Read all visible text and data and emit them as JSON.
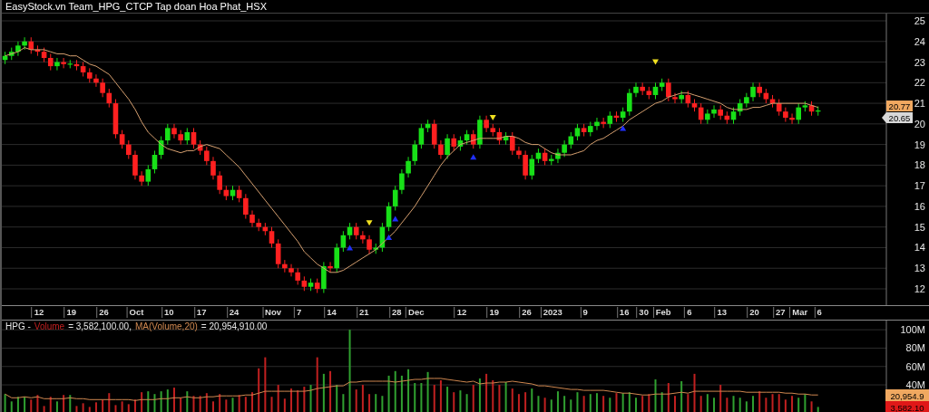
{
  "window": {
    "title": "EasyStock.vn Team_HPG_CTCP Tap doan Hoa Phat_HSX"
  },
  "price_chart": {
    "chart_data": {
      "type": "candlestick",
      "grid": true,
      "ylim": [
        12,
        25
      ],
      "yticks": [
        12,
        13,
        14,
        15,
        16,
        17,
        18,
        19,
        20,
        21,
        22,
        23,
        24,
        25
      ],
      "categories": [
        null,
        null,
        null,
        null,
        null,
        "12",
        null,
        null,
        null,
        null,
        "19",
        null,
        null,
        null,
        null,
        "26",
        null,
        null,
        null,
        null,
        "Oct",
        null,
        null,
        null,
        null,
        "10",
        null,
        null,
        null,
        null,
        "17",
        null,
        null,
        null,
        null,
        "24",
        null,
        null,
        null,
        null,
        null,
        "Nov",
        null,
        null,
        null,
        "7",
        null,
        null,
        null,
        null,
        "14",
        null,
        null,
        null,
        null,
        "21",
        null,
        null,
        null,
        null,
        "28",
        null,
        null,
        "Dec",
        null,
        null,
        null,
        null,
        null,
        null,
        "12",
        null,
        null,
        null,
        null,
        "19",
        null,
        null,
        null,
        null,
        "26",
        null,
        null,
        null,
        "2023",
        null,
        null,
        null,
        null,
        "9",
        null,
        null,
        null,
        null,
        null,
        "16",
        null,
        null,
        "30",
        null,
        null,
        "Feb",
        null,
        null,
        null,
        "6",
        null,
        null,
        null,
        null,
        "13",
        null,
        null,
        null,
        null,
        "20",
        null,
        null,
        null,
        "27",
        null,
        null,
        "Mar",
        null,
        null,
        "6"
      ],
      "ohlc": [
        [
          23.1,
          23.5,
          22.9,
          23.3
        ],
        [
          23.3,
          23.7,
          23.1,
          23.5
        ],
        [
          23.5,
          24.0,
          23.3,
          23.8
        ],
        [
          23.8,
          24.2,
          23.6,
          24.0
        ],
        [
          24.0,
          24.2,
          23.4,
          23.6
        ],
        [
          23.6,
          23.8,
          23.3,
          23.5
        ],
        [
          23.5,
          23.7,
          23.0,
          23.2
        ],
        [
          23.2,
          23.4,
          22.6,
          22.8
        ],
        [
          22.8,
          23.2,
          22.6,
          23.0
        ],
        [
          23.0,
          23.2,
          22.7,
          22.9
        ],
        [
          22.9,
          23.1,
          22.7,
          22.9
        ],
        [
          22.9,
          23.1,
          22.6,
          22.8
        ],
        [
          22.8,
          23.0,
          22.3,
          22.5
        ],
        [
          22.5,
          22.7,
          22.0,
          22.2
        ],
        [
          22.2,
          22.4,
          21.8,
          22.0
        ],
        [
          22.0,
          22.2,
          21.3,
          21.5
        ],
        [
          21.5,
          21.7,
          20.8,
          21.0
        ],
        [
          21.0,
          21.2,
          19.3,
          19.5
        ],
        [
          19.5,
          19.7,
          18.8,
          19.0
        ],
        [
          19.0,
          19.2,
          18.3,
          18.5
        ],
        [
          18.5,
          18.7,
          17.3,
          17.5
        ],
        [
          17.5,
          17.7,
          17.0,
          17.2
        ],
        [
          17.2,
          18.0,
          17.0,
          17.8
        ],
        [
          17.8,
          18.7,
          17.6,
          18.5
        ],
        [
          18.5,
          19.4,
          18.3,
          19.2
        ],
        [
          19.2,
          20.0,
          19.0,
          19.8
        ],
        [
          19.8,
          20.0,
          19.3,
          19.5
        ],
        [
          19.5,
          19.7,
          19.0,
          19.2
        ],
        [
          19.2,
          19.8,
          19.0,
          19.6
        ],
        [
          19.6,
          19.8,
          18.8,
          19.0
        ],
        [
          19.0,
          19.2,
          18.5,
          18.7
        ],
        [
          18.7,
          18.9,
          18.0,
          18.2
        ],
        [
          18.2,
          18.4,
          17.3,
          17.5
        ],
        [
          17.5,
          17.7,
          16.6,
          16.8
        ],
        [
          16.8,
          17.0,
          16.3,
          16.5
        ],
        [
          16.5,
          17.0,
          16.3,
          16.8
        ],
        [
          16.8,
          17.0,
          16.2,
          16.4
        ],
        [
          16.4,
          16.6,
          15.4,
          15.6
        ],
        [
          15.6,
          15.8,
          15.0,
          15.2
        ],
        [
          15.2,
          15.4,
          14.8,
          15.0
        ],
        [
          15.0,
          15.2,
          14.6,
          14.8
        ],
        [
          14.8,
          15.0,
          14.0,
          14.2
        ],
        [
          14.2,
          14.4,
          13.0,
          13.2
        ],
        [
          13.2,
          13.4,
          12.8,
          13.0
        ],
        [
          13.0,
          13.2,
          12.6,
          12.8
        ],
        [
          12.8,
          13.0,
          12.2,
          12.4
        ],
        [
          12.4,
          12.6,
          11.9,
          12.1
        ],
        [
          12.1,
          12.5,
          11.9,
          12.3
        ],
        [
          12.3,
          12.5,
          11.8,
          12.0
        ],
        [
          12.0,
          13.3,
          11.8,
          13.1
        ],
        [
          13.1,
          13.3,
          12.8,
          13.0
        ],
        [
          13.0,
          14.2,
          12.8,
          14.0
        ],
        [
          14.0,
          14.8,
          13.8,
          14.6
        ],
        [
          14.6,
          15.2,
          14.4,
          15.0
        ],
        [
          15.0,
          15.2,
          14.4,
          14.6
        ],
        [
          14.6,
          14.8,
          14.2,
          14.4
        ],
        [
          14.4,
          14.6,
          13.7,
          13.9
        ],
        [
          13.9,
          14.2,
          13.7,
          14.0
        ],
        [
          14.0,
          15.2,
          13.8,
          15.0
        ],
        [
          15.0,
          16.2,
          14.8,
          16.0
        ],
        [
          16.0,
          17.0,
          15.8,
          16.8
        ],
        [
          16.8,
          17.8,
          16.6,
          17.6
        ],
        [
          17.6,
          18.4,
          17.4,
          18.2
        ],
        [
          18.2,
          19.2,
          18.0,
          19.0
        ],
        [
          19.0,
          20.0,
          18.8,
          19.8
        ],
        [
          19.8,
          20.2,
          19.6,
          20.0
        ],
        [
          20.0,
          20.2,
          18.8,
          19.0
        ],
        [
          19.0,
          19.2,
          18.3,
          18.5
        ],
        [
          18.5,
          19.5,
          18.3,
          19.3
        ],
        [
          19.3,
          19.5,
          18.7,
          18.9
        ],
        [
          18.9,
          19.4,
          18.7,
          19.2
        ],
        [
          19.2,
          19.7,
          19.0,
          19.5
        ],
        [
          19.5,
          19.7,
          18.8,
          19.0
        ],
        [
          19.0,
          20.4,
          18.8,
          20.2
        ],
        [
          20.2,
          20.4,
          19.6,
          19.8
        ],
        [
          19.8,
          20.0,
          19.4,
          19.6
        ],
        [
          19.6,
          19.8,
          19.0,
          19.2
        ],
        [
          19.2,
          19.6,
          19.0,
          19.4
        ],
        [
          19.4,
          19.6,
          18.5,
          18.7
        ],
        [
          18.7,
          18.9,
          18.3,
          18.5
        ],
        [
          18.5,
          18.7,
          17.3,
          17.5
        ],
        [
          17.5,
          18.5,
          17.3,
          18.3
        ],
        [
          18.3,
          18.8,
          18.1,
          18.6
        ],
        [
          18.6,
          18.8,
          18.0,
          18.2
        ],
        [
          18.2,
          18.5,
          18.0,
          18.3
        ],
        [
          18.3,
          18.8,
          18.1,
          18.6
        ],
        [
          18.6,
          19.2,
          18.4,
          19.0
        ],
        [
          19.0,
          19.6,
          18.8,
          19.4
        ],
        [
          19.4,
          20.0,
          19.2,
          19.8
        ],
        [
          19.8,
          20.0,
          19.4,
          19.6
        ],
        [
          19.6,
          20.1,
          19.4,
          19.9
        ],
        [
          19.9,
          20.3,
          19.7,
          20.1
        ],
        [
          20.1,
          20.3,
          19.8,
          20.0
        ],
        [
          20.0,
          20.6,
          19.8,
          20.4
        ],
        [
          20.4,
          20.6,
          20.1,
          20.3
        ],
        [
          20.3,
          20.8,
          20.1,
          20.6
        ],
        [
          20.6,
          21.7,
          20.4,
          21.5
        ],
        [
          21.5,
          22.0,
          21.3,
          21.8
        ],
        [
          21.8,
          22.0,
          21.4,
          21.6
        ],
        [
          21.6,
          21.8,
          21.2,
          21.4
        ],
        [
          21.4,
          22.0,
          21.2,
          21.8
        ],
        [
          21.8,
          22.2,
          21.6,
          22.0
        ],
        [
          22.0,
          22.2,
          21.1,
          21.3
        ],
        [
          21.3,
          21.5,
          21.0,
          21.2
        ],
        [
          21.2,
          21.6,
          21.0,
          21.4
        ],
        [
          21.4,
          21.6,
          20.8,
          21.0
        ],
        [
          21.0,
          21.2,
          20.6,
          20.8
        ],
        [
          20.8,
          21.0,
          20.0,
          20.2
        ],
        [
          20.2,
          20.7,
          20.0,
          20.5
        ],
        [
          20.5,
          20.9,
          20.3,
          20.7
        ],
        [
          20.7,
          20.9,
          20.2,
          20.4
        ],
        [
          20.4,
          20.6,
          20.0,
          20.2
        ],
        [
          20.2,
          20.8,
          20.0,
          20.6
        ],
        [
          20.6,
          21.2,
          20.4,
          21.0
        ],
        [
          21.0,
          21.5,
          20.8,
          21.3
        ],
        [
          21.3,
          22.0,
          21.1,
          21.8
        ],
        [
          21.8,
          22.0,
          21.3,
          21.5
        ],
        [
          21.5,
          21.7,
          21.0,
          21.2
        ],
        [
          21.2,
          21.4,
          20.8,
          21.0
        ],
        [
          21.0,
          21.2,
          20.4,
          20.6
        ],
        [
          20.6,
          20.8,
          20.1,
          20.3
        ],
        [
          20.3,
          20.5,
          20.0,
          20.2
        ],
        [
          20.2,
          21.0,
          20.0,
          20.8
        ],
        [
          20.8,
          21.1,
          20.6,
          20.9
        ],
        [
          20.9,
          21.1,
          20.4,
          20.6
        ],
        [
          20.6,
          20.85,
          20.4,
          20.65
        ]
      ],
      "series": [
        {
          "type": "line",
          "color": "#d6a070",
          "values": [
            23.3,
            23.4,
            23.5,
            23.7,
            23.6,
            23.6,
            23.6,
            23.5,
            23.4,
            23.4,
            23.3,
            23.3,
            23.1,
            22.9,
            22.8,
            22.6,
            22.4,
            22.0,
            21.6,
            21.2,
            20.7,
            20.1,
            19.6,
            19.3,
            19.0,
            18.8,
            18.7,
            18.6,
            18.7,
            18.7,
            18.9,
            19.0,
            18.9,
            18.8,
            18.5,
            18.2,
            17.9,
            17.5,
            17.1,
            16.7,
            16.3,
            15.9,
            15.5,
            15.1,
            14.7,
            14.3,
            13.8,
            13.5,
            13.2,
            13.0,
            12.8,
            12.8,
            12.9,
            13.1,
            13.3,
            13.5,
            13.7,
            13.9,
            14.2,
            14.5,
            14.8,
            15.2,
            15.6,
            16.0,
            16.5,
            17.0,
            17.5,
            18.0,
            18.4,
            18.7,
            19.0,
            19.1,
            19.2,
            19.3,
            19.3,
            19.3,
            19.3,
            19.4,
            19.4,
            19.3,
            19.1,
            19.0,
            19.0,
            18.8,
            18.6,
            18.5,
            18.5,
            18.5,
            18.6,
            18.7,
            19.0,
            19.2,
            19.3,
            19.5,
            19.7,
            19.9,
            20.2,
            20.4,
            20.6,
            20.8,
            21.0,
            21.1,
            21.3,
            21.4,
            21.5,
            21.5,
            21.4,
            21.3,
            21.2,
            21.1,
            21.0,
            20.8,
            20.7,
            20.7,
            20.7,
            20.8,
            20.8,
            20.9,
            21.0,
            21.0,
            21.0,
            21.0,
            21.0,
            21.0,
            20.9,
            20.8
          ]
        },
        {
          "type": "scatter",
          "color": "#2030ff",
          "values": [
            null,
            null,
            null,
            null,
            null,
            null,
            null,
            null,
            null,
            null,
            null,
            null,
            null,
            null,
            null,
            null,
            null,
            null,
            null,
            null,
            null,
            null,
            null,
            null,
            null,
            null,
            null,
            null,
            null,
            null,
            null,
            null,
            null,
            null,
            null,
            null,
            null,
            null,
            null,
            null,
            null,
            null,
            null,
            null,
            null,
            null,
            null,
            null,
            null,
            null,
            null,
            null,
            null,
            14.0,
            null,
            null,
            null,
            null,
            null,
            14.5,
            15.4,
            null,
            null,
            null,
            null,
            null,
            null,
            null,
            null,
            null,
            null,
            null,
            18.4,
            null,
            null,
            null,
            null,
            null,
            null,
            null,
            null,
            null,
            null,
            null,
            null,
            null,
            null,
            null,
            null,
            null,
            null,
            null,
            null,
            null,
            null,
            19.8,
            null,
            null,
            null,
            null,
            null,
            null,
            null,
            null,
            null,
            null,
            null,
            null,
            null,
            null,
            null,
            null,
            null,
            null,
            null,
            null,
            null,
            null,
            null,
            null,
            null,
            null,
            null,
            null,
            null,
            null
          ]
        },
        {
          "type": "scatter",
          "color": "#f0e020",
          "values": [
            null,
            null,
            null,
            null,
            null,
            null,
            null,
            null,
            null,
            null,
            null,
            null,
            null,
            null,
            null,
            null,
            null,
            null,
            null,
            null,
            null,
            null,
            null,
            null,
            null,
            null,
            null,
            null,
            null,
            null,
            null,
            null,
            null,
            null,
            null,
            null,
            null,
            null,
            null,
            null,
            null,
            null,
            null,
            null,
            null,
            null,
            null,
            null,
            null,
            null,
            null,
            null,
            null,
            null,
            null,
            null,
            15.2,
            null,
            null,
            null,
            null,
            null,
            null,
            null,
            null,
            null,
            null,
            null,
            null,
            null,
            null,
            null,
            null,
            null,
            null,
            20.3,
            null,
            null,
            null,
            null,
            null,
            null,
            null,
            null,
            null,
            null,
            null,
            null,
            null,
            null,
            null,
            null,
            null,
            null,
            null,
            null,
            null,
            null,
            null,
            null,
            23.0,
            null,
            null,
            null,
            null,
            null,
            null,
            null,
            null,
            null,
            null,
            null,
            null,
            null,
            null,
            null,
            null,
            null,
            null,
            null,
            null,
            null,
            null,
            null,
            null,
            null
          ]
        }
      ]
    },
    "price_tags": [
      {
        "label": "20.77",
        "kind": "ma"
      },
      {
        "label": "20.65",
        "kind": "last"
      }
    ]
  },
  "volume_chart": {
    "legend": [
      {
        "text": "HPG -",
        "kind": "plain"
      },
      {
        "kind": "volume"
      },
      {
        "text": "= 3,582,100.00,",
        "kind": "plain"
      },
      {
        "kind": "ma"
      },
      {
        "text": "= 20,954,910.00",
        "kind": "plain"
      }
    ],
    "chart_data": {
      "type": "bar",
      "grid": true,
      "ylim": [
        9.5,
        110
      ],
      "yticks": [
        {
          "value": 40,
          "label": "40M"
        },
        {
          "value": 60,
          "label": "60M"
        },
        {
          "value": 80,
          "label": "80M"
        },
        {
          "value": 100,
          "label": "100M"
        }
      ],
      "series": [
        {
          "name": "Volume",
          "color": "#c02020",
          "values": [
            null,
            null,
            null,
            null,
            24,
            29,
            17,
            27,
            null,
            29,
            null,
            17,
            20,
            16,
            21,
            24,
            31,
            18,
            22,
            19,
            24,
            32,
            null,
            null,
            null,
            null,
            37,
            26,
            null,
            28,
            28,
            31,
            22,
            30,
            24,
            null,
            29,
            27,
            32,
            58,
            70,
            27,
            40,
            25,
            36,
            34,
            38,
            null,
            70,
            null,
            55,
            null,
            null,
            null,
            35,
            40,
            30,
            null,
            null,
            null,
            null,
            null,
            null,
            null,
            null,
            null,
            40,
            45,
            null,
            32,
            null,
            null,
            40,
            null,
            52,
            45,
            40,
            null,
            36,
            30,
            32,
            null,
            null,
            26,
            null,
            null,
            null,
            null,
            null,
            28,
            null,
            null,
            28,
            null,
            31,
            null,
            null,
            null,
            28,
            30,
            null,
            null,
            42,
            28,
            null,
            30,
            52,
            28,
            null,
            null,
            40,
            26,
            null,
            null,
            null,
            null,
            33,
            26,
            30,
            30,
            24,
            28,
            null,
            null,
            22,
            null
          ]
        },
        {
          "color": "#30a030",
          "values": [
            30,
            22,
            27,
            27,
            null,
            null,
            null,
            null,
            22,
            null,
            29,
            null,
            null,
            null,
            null,
            null,
            null,
            null,
            null,
            null,
            null,
            null,
            33,
            30,
            33,
            35,
            null,
            null,
            33,
            null,
            null,
            null,
            null,
            null,
            null,
            26,
            null,
            null,
            null,
            null,
            null,
            null,
            null,
            null,
            null,
            null,
            null,
            40,
            null,
            52,
            null,
            40,
            30,
            100,
            null,
            null,
            null,
            30,
            28,
            50,
            55,
            50,
            57,
            42,
            42,
            54,
            null,
            null,
            38,
            null,
            34,
            30,
            null,
            47,
            null,
            null,
            null,
            43,
            null,
            null,
            null,
            36,
            28,
            null,
            24,
            33,
            28,
            24,
            32,
            null,
            30,
            31,
            null,
            26,
            null,
            31,
            32,
            26,
            null,
            null,
            46,
            32,
            null,
            null,
            44,
            null,
            null,
            null,
            30,
            26,
            null,
            null,
            28,
            26,
            22,
            28,
            null,
            null,
            null,
            null,
            null,
            null,
            26,
            30,
            null,
            16
          ]
        },
        {
          "name": "MA(Volume,20)",
          "type": "line",
          "color": "#d08850",
          "values": [
            30,
            26,
            26,
            27,
            26,
            27,
            25,
            25,
            25,
            25,
            26,
            25,
            25,
            24,
            24,
            24,
            24,
            24,
            24,
            24,
            23,
            24,
            24,
            24,
            25,
            25,
            26,
            26,
            27,
            26,
            26,
            27,
            27,
            28,
            28,
            28,
            28,
            29,
            29,
            31,
            33,
            33,
            33,
            33,
            33,
            33,
            33,
            34,
            36,
            37,
            38,
            39,
            39,
            43,
            43,
            44,
            44,
            44,
            44,
            44,
            43,
            44,
            45,
            46,
            46,
            47,
            47,
            47,
            46,
            45,
            44,
            43,
            44,
            41,
            42,
            42,
            43,
            43,
            44,
            43,
            42,
            41,
            39,
            39,
            38,
            37,
            36,
            35,
            35,
            34,
            34,
            34,
            34,
            33,
            32,
            31,
            31,
            30,
            29,
            29,
            30,
            30,
            30,
            31,
            32,
            31,
            33,
            33,
            33,
            33,
            33,
            33,
            33,
            33,
            32,
            32,
            32,
            32,
            32,
            32,
            31,
            31,
            30,
            30,
            29,
            29
          ]
        }
      ]
    },
    "value_tags": [
      {
        "label": "20,954.9",
        "kind": "ma"
      },
      {
        "label": "3,582.10",
        "kind": "volume"
      }
    ]
  }
}
